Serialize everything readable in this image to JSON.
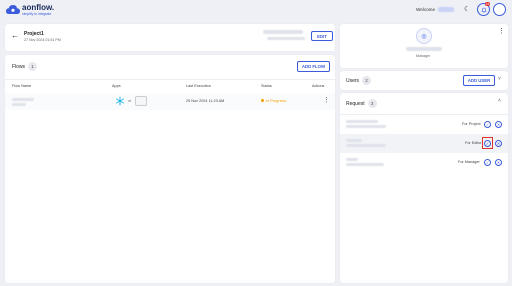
{
  "app": {
    "logo_text": "aonflow.",
    "tagline": "simplify to integrate"
  },
  "header": {
    "welcome": "Welcome",
    "notification_count": "15"
  },
  "project": {
    "name": "Project1",
    "date": "27 Nov 2024 01:51 PM",
    "edit_label": "EDIT"
  },
  "flows": {
    "title": "Flows",
    "count": "1",
    "add_label": "ADD FLOW",
    "columns": [
      "Flow Name",
      "Apps",
      "Last Execution",
      "Status",
      "Actions"
    ],
    "rows": [
      {
        "last_execution": "25 Nov 2024 11:23 AM",
        "status": "In Progress"
      }
    ]
  },
  "profile": {
    "role": "Manager"
  },
  "users": {
    "title": "Users",
    "count": "2",
    "add_label": "ADD USER"
  },
  "requests": {
    "title": "Request",
    "count": "3",
    "items": [
      {
        "role": "For Project"
      },
      {
        "role": "For Editor"
      },
      {
        "role": "For Manager"
      }
    ]
  },
  "colors": {
    "accent": "#3b5bdb",
    "status": "#f59f00",
    "highlight": "#e03131",
    "background": "#eef0f6"
  }
}
